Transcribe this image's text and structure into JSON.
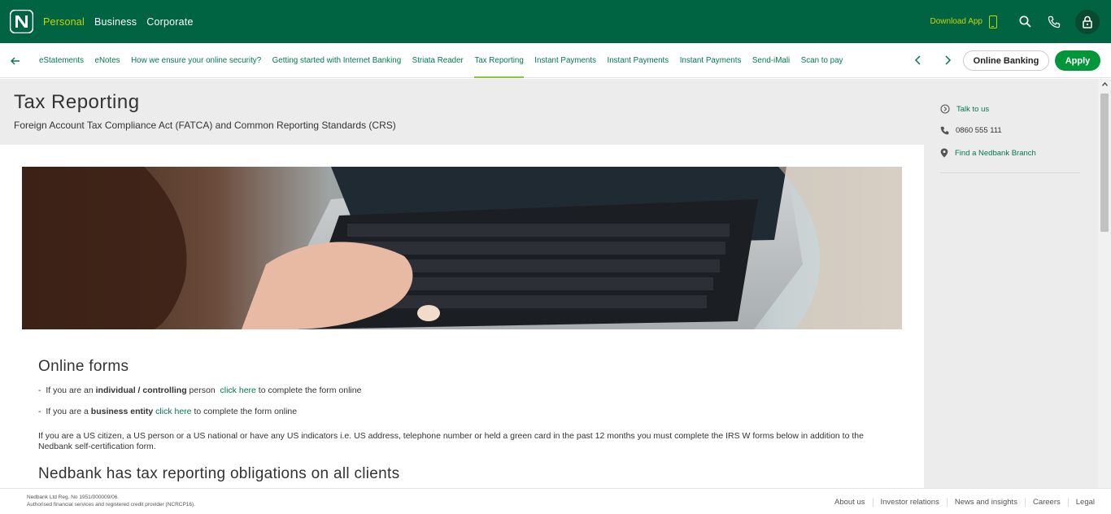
{
  "header": {
    "segments": [
      "Personal",
      "Business",
      "Corporate"
    ],
    "active_segment": "Personal",
    "download_app": "Download App",
    "colors": {
      "brand_green": "#006341",
      "accent_lime": "#c8d400",
      "button_green": "#009639",
      "link_green": "#007a4d"
    }
  },
  "subnav": {
    "items": [
      "eStatements",
      "eNotes",
      "How we ensure your online security?",
      "Getting started with Internet Banking",
      "Striata Reader",
      "Tax Reporting",
      "Instant Payments",
      "Instant Payments",
      "Instant Payments",
      "Send-iMali",
      "Scan to pay"
    ],
    "active": "Tax Reporting",
    "online_banking": "Online Banking",
    "apply": "Apply"
  },
  "page": {
    "title": "Tax Reporting",
    "subtitle": "Foreign Account Tax Compliance Act (FATCA) and Common Reporting Standards (CRS)"
  },
  "sidebar": {
    "talk": "Talk to us",
    "phone": "0860 555 111",
    "branch": "Find a Nedbank Branch"
  },
  "content": {
    "heading": "Online forms",
    "bullet1": {
      "prefix": "If you are an ",
      "bold": "individual / controlling",
      "mid": " person ",
      "link": "click here",
      "suffix": " to complete the form online"
    },
    "bullet2": {
      "prefix": "If you are a ",
      "bold": "business entity",
      "link": "click here",
      "suffix": " to complete the form online"
    },
    "paragraph": "If you are a US citizen, a US person or a US national or have any US indicators i.e. US address, telephone number or held a green card in the past 12 months you must complete the IRS W forms below in addition to the Nedbank self-certification form.",
    "heading2": "Nedbank has tax reporting obligations on all clients"
  },
  "footer": {
    "legal1": "Nedbank Ltd Reg. No 1951/000009/06.",
    "legal2": "Authorised financial services and registered credit provider (NCRCP16).",
    "links": [
      "About us",
      "Investor relations",
      "News and insights",
      "Careers",
      "Legal"
    ]
  }
}
